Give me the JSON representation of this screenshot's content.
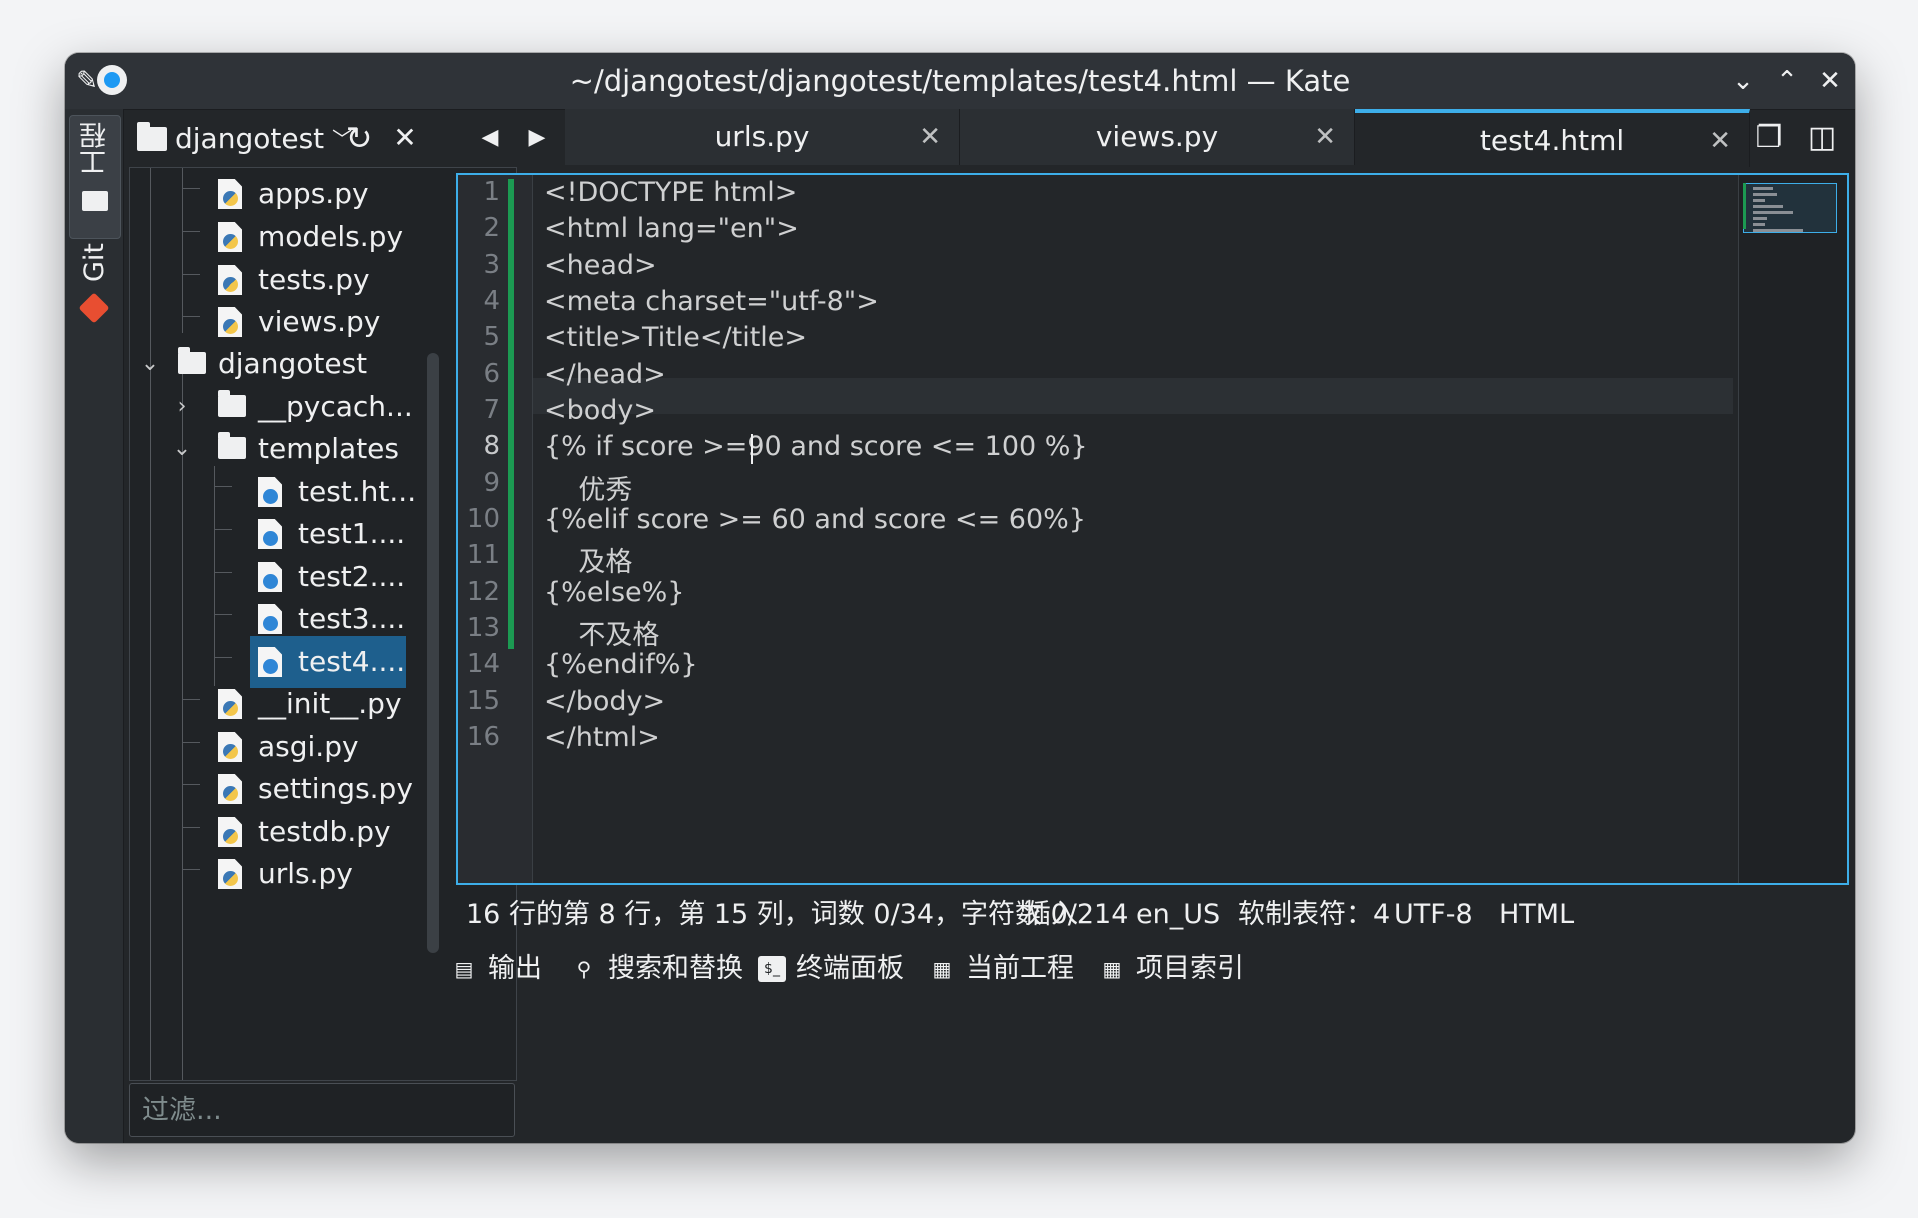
{
  "window": {
    "title": "~/djangotest/djangotest/templates/test4.html — Kate"
  },
  "left_strip": {
    "project_tab": "工程",
    "git_tab": "Git"
  },
  "file_tree": {
    "project_name": "djangotest",
    "rows": [
      {
        "label": "apps.py",
        "kind": "py"
      },
      {
        "label": "models.py",
        "kind": "py"
      },
      {
        "label": "tests.py",
        "kind": "py"
      },
      {
        "label": "views.py",
        "kind": "py"
      },
      {
        "label": "djangotest",
        "kind": "folder"
      },
      {
        "label": "__pycach...",
        "kind": "folder"
      },
      {
        "label": "templates",
        "kind": "folder"
      },
      {
        "label": "test.ht...",
        "kind": "html"
      },
      {
        "label": "test1....",
        "kind": "html"
      },
      {
        "label": "test2....",
        "kind": "html"
      },
      {
        "label": "test3....",
        "kind": "html"
      },
      {
        "label": "test4....",
        "kind": "html"
      },
      {
        "label": "__init__.py",
        "kind": "py"
      },
      {
        "label": "asgi.py",
        "kind": "py"
      },
      {
        "label": "settings.py",
        "kind": "py"
      },
      {
        "label": "testdb.py",
        "kind": "py"
      },
      {
        "label": "urls.py",
        "kind": "py"
      }
    ],
    "filter_placeholder": "过滤..."
  },
  "tabs": [
    {
      "label": "urls.py"
    },
    {
      "label": "views.py"
    },
    {
      "label": "test4.html"
    }
  ],
  "editor": {
    "line_numbers": [
      "1",
      "2",
      "3",
      "4",
      "5",
      "6",
      "7",
      "8",
      "9",
      "10",
      "11",
      "12",
      "13",
      "14",
      "15",
      "16"
    ],
    "lines": [
      "<!DOCTYPE html>",
      "<html lang=\"en\">",
      "<head>",
      "<meta charset=\"utf-8\">",
      "<title>Title</title>",
      "</head>",
      "<body>",
      "{% if score >=90 and score <= 100 %}",
      "    优秀",
      "{%elif score >= 60 and score <= 60%}",
      "    及格",
      "{%else%}",
      "    不及格",
      "{%endif%}",
      "</body>",
      "</html>"
    ]
  },
  "status": {
    "position": "16 行的第 8 行，第 15 列，词数 0/34，字符数 0/214",
    "mode": "插入",
    "language": "en_US",
    "indent": "软制表符：4",
    "encoding": "UTF-8",
    "syntax": "HTML"
  },
  "bottom_tools": [
    {
      "label": "输出"
    },
    {
      "label": "搜索和替换"
    },
    {
      "label": "终端面板"
    },
    {
      "label": "当前工程"
    },
    {
      "label": "项目索引"
    }
  ],
  "colors": {
    "accent": "#3daee9",
    "selection": "#1e5f8d",
    "modified": "#1c9a52",
    "tag": "#2980b9",
    "attr": "#27ae60",
    "string": "#da4453"
  }
}
